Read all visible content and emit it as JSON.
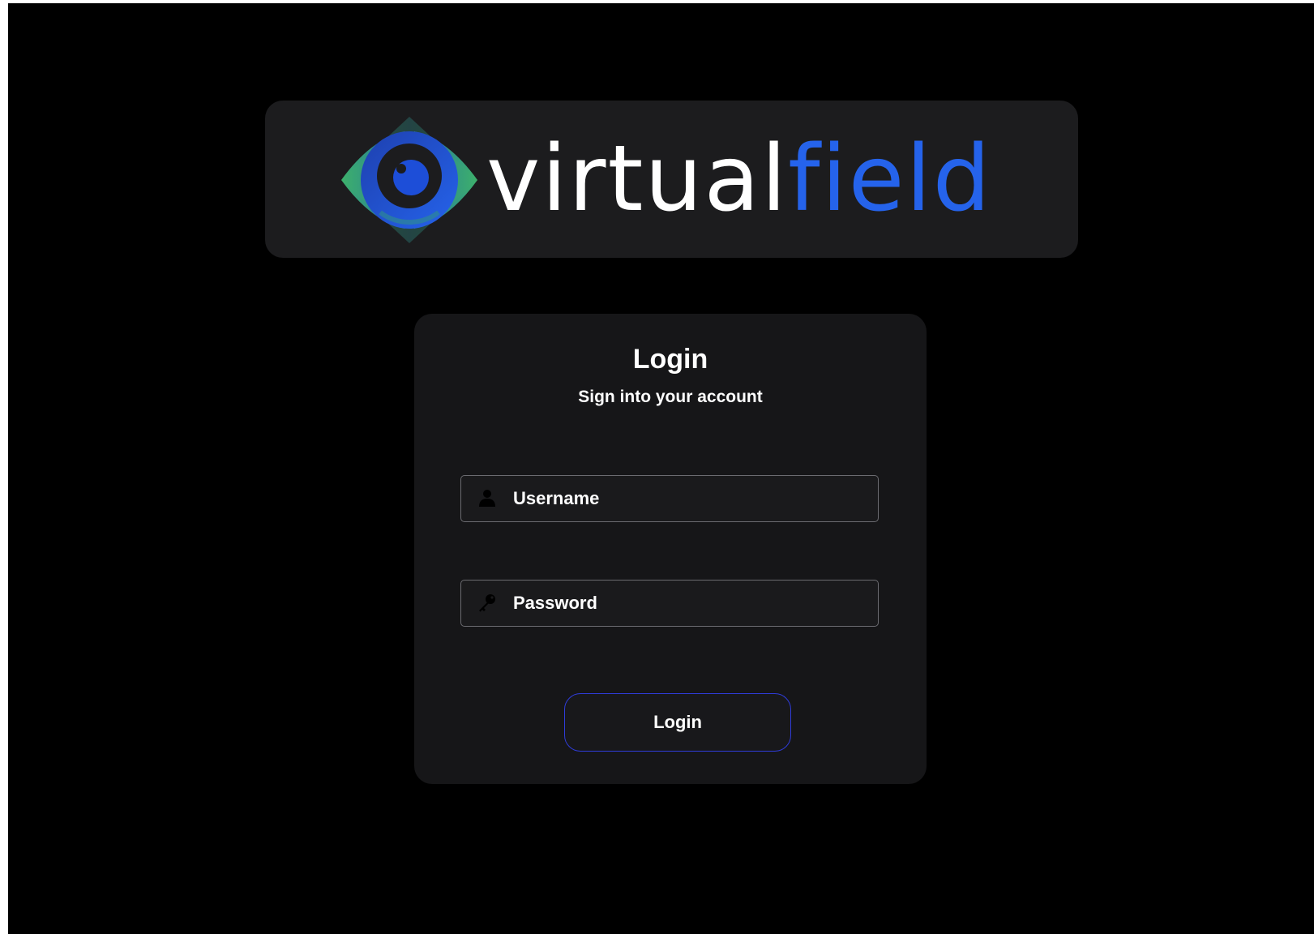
{
  "logo": {
    "brand_part1": "virtual",
    "brand_part2": "field",
    "icon": "eye-logo-icon",
    "colors": {
      "brand_white": "#ffffff",
      "brand_blue": "#2563eb",
      "eye_green": "#3db06b",
      "eye_blue": "#1d4ed8",
      "pupil": "#1c1c1e"
    }
  },
  "login": {
    "title": "Login",
    "subtitle": "Sign into your account",
    "username": {
      "placeholder": "Username",
      "value": "",
      "icon": "user-icon"
    },
    "password": {
      "placeholder": "Password",
      "value": "",
      "icon": "key-icon"
    },
    "button_label": "Login"
  },
  "colors": {
    "background": "#000000",
    "panel": "#1c1c1e",
    "card": "#161618",
    "field_border": "#6b6b70",
    "button_border": "#2f3cd9",
    "text": "#ffffff"
  }
}
